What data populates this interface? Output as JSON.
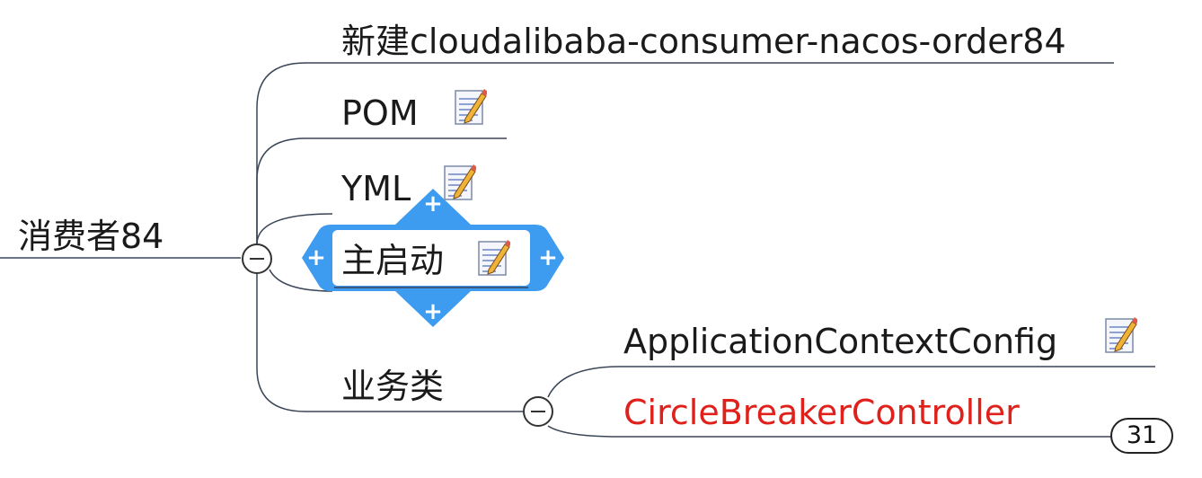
{
  "colors": {
    "line": "#3a4558",
    "text": "#1a1a1a",
    "highlight_text": "#e0201a",
    "selection": "#3d9bf0"
  },
  "root": {
    "label": "消费者84"
  },
  "branches": [
    {
      "label": "新建cloudalibaba-consumer-nacos-order84",
      "has_note": false
    },
    {
      "label": "POM",
      "has_note": true
    },
    {
      "label": "YML",
      "has_note": true
    },
    {
      "label": "主启动",
      "has_note": true,
      "selected": true
    },
    {
      "label": "业务类",
      "has_note": false,
      "collapsed": false,
      "children": [
        {
          "label": "ApplicationContextConfig",
          "has_note": true
        },
        {
          "label": "CircleBreakerController",
          "has_note": false,
          "highlighted": true
        }
      ]
    }
  ],
  "hidden_count": "31",
  "icons": {
    "note": "note-pencil-icon",
    "collapse": "collapse-minus-icon",
    "add": "add-plus-icon"
  }
}
